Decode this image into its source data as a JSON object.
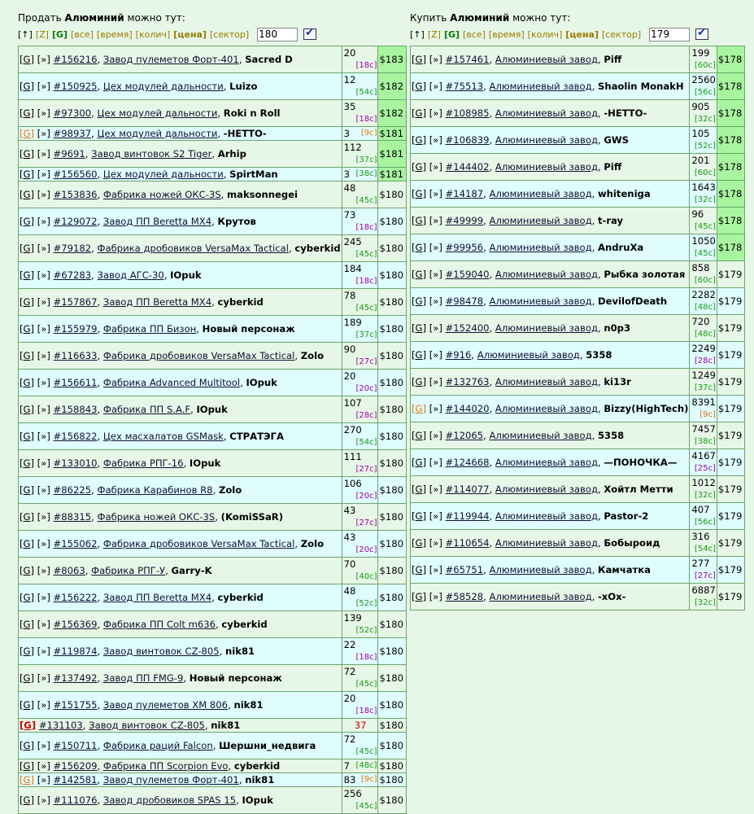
{
  "sell": {
    "title_prefix": "Продать",
    "title_item": "Алюминий",
    "title_suffix": "можно тут:",
    "sort": {
      "up": "[↑]",
      "z": "[Z]",
      "g": "[G]",
      "all": "[все]",
      "time": "[время]",
      "qty": "[колич]",
      "price": "[цена]",
      "sector": "[сектор]"
    },
    "input_value": "180",
    "rows": [
      {
        "g": "[G]",
        "r": "[»]",
        "id": "#156216",
        "factory": "Завод пулеметов Форт-401",
        "owner": "Sacred D",
        "qty": "20",
        "age": "[18c]",
        "age_color": "purple",
        "price": "$183",
        "hl": true
      },
      {
        "g": "[G]",
        "r": "[»]",
        "id": "#150925",
        "factory": "Цех модулей дальности",
        "owner": "Luizo",
        "qty": "12",
        "age": "[54c]",
        "age_color": "green",
        "price": "$182",
        "hl": true
      },
      {
        "g": "[G]",
        "r": "[»]",
        "id": "#97300",
        "factory": "Цех модулей дальности",
        "owner": "Roki n Roll",
        "qty": "35",
        "age": "[18c]",
        "age_color": "purple",
        "price": "$182",
        "hl": true
      },
      {
        "g": "[G]",
        "g_color": "orange",
        "r": "[»]",
        "id": "#98937",
        "factory": "Цех модулей дальности",
        "owner": "-НЕТТО-",
        "qty": "3",
        "age": "[9c]",
        "age_color": "orange",
        "price": "$181",
        "hl": true
      },
      {
        "g": "[G]",
        "r": "[»]",
        "id": "#9691",
        "factory": "Завод винтовок S2 Tiger",
        "owner": "Arhip",
        "qty": "112",
        "age": "[37c]",
        "age_color": "green",
        "price": "$181",
        "hl": true
      },
      {
        "g": "[G]",
        "r": "[»]",
        "id": "#156560",
        "factory": "Цех модулей дальности",
        "owner": "SpirtMan",
        "qty": "3",
        "age": "[38c]",
        "age_color": "green",
        "price": "$181",
        "hl": true
      },
      {
        "g": "[G]",
        "r": "[»]",
        "id": "#153836",
        "factory": "Фабрика ножей ОКС-3S",
        "owner": "maksonnegei",
        "qty": "48",
        "age": "[45c]",
        "age_color": "green",
        "price": "$180"
      },
      {
        "g": "[G]",
        "r": "[»]",
        "id": "#129072",
        "factory": "Завод ПП Beretta MX4",
        "owner": "Крутов",
        "qty": "73",
        "age": "[18c]",
        "age_color": "purple",
        "price": "$180"
      },
      {
        "g": "[G]",
        "r": "[»]",
        "id": "#79182",
        "factory": "Фабрика дробовиков VersaMax Tactical",
        "owner": "cyberkid",
        "qty": "245",
        "age": "[45c]",
        "age_color": "green",
        "price": "$180"
      },
      {
        "g": "[G]",
        "r": "[»]",
        "id": "#67283",
        "factory": "Завод АГС-30",
        "owner": "IOpuk",
        "qty": "184",
        "age": "[18c]",
        "age_color": "purple",
        "price": "$180"
      },
      {
        "g": "[G]",
        "r": "[»]",
        "id": "#157867",
        "factory": "Завод ПП Beretta MX4",
        "owner": "cyberkid",
        "qty": "78",
        "age": "[45c]",
        "age_color": "green",
        "price": "$180"
      },
      {
        "g": "[G]",
        "r": "[»]",
        "id": "#155979",
        "factory": "Фабрика ПП Бизон",
        "owner": "Новый персонаж",
        "qty": "189",
        "age": "[37c]",
        "age_color": "green",
        "price": "$180"
      },
      {
        "g": "[G]",
        "r": "[»]",
        "id": "#116633",
        "factory": "Фабрика дробовиков VersaMax Tactical",
        "owner": "Zolo",
        "qty": "90",
        "age": "[27c]",
        "age_color": "purple",
        "price": "$180"
      },
      {
        "g": "[G]",
        "r": "[»]",
        "id": "#156611",
        "factory": "Фабрика Advanced Multitool",
        "owner": "IOpuk",
        "qty": "20",
        "age": "[20c]",
        "age_color": "purple",
        "price": "$180"
      },
      {
        "g": "[G]",
        "r": "[»]",
        "id": "#158843",
        "factory": "Фабрика ПП S.A.F",
        "owner": "IOpuk",
        "qty": "107",
        "age": "[28c]",
        "age_color": "purple",
        "price": "$180"
      },
      {
        "g": "[G]",
        "r": "[»]",
        "id": "#156822",
        "factory": "Цех масхалатов GSMask",
        "owner": "СТРАТЭГА",
        "qty": "270",
        "age": "[54c]",
        "age_color": "green",
        "price": "$180"
      },
      {
        "g": "[G]",
        "r": "[»]",
        "id": "#133010",
        "factory": "Фабрика РПГ-16",
        "owner": "IOpuk",
        "qty": "111",
        "age": "[27c]",
        "age_color": "purple",
        "price": "$180"
      },
      {
        "g": "[G]",
        "r": "[»]",
        "id": "#86225",
        "factory": "Фабрика Карабинов R8",
        "owner": "Zolo",
        "qty": "106",
        "age": "[20c]",
        "age_color": "purple",
        "price": "$180"
      },
      {
        "g": "[G]",
        "r": "[»]",
        "id": "#88315",
        "factory": "Фабрика ножей ОКС-3S",
        "owner": "(KomiSSaR)",
        "qty": "43",
        "age": "[27c]",
        "age_color": "purple",
        "price": "$180"
      },
      {
        "g": "[G]",
        "r": "[»]",
        "id": "#155062",
        "factory": "Фабрика дробовиков VersaMax Tactical",
        "owner": "Zolo",
        "qty": "43",
        "age": "[20c]",
        "age_color": "purple",
        "price": "$180"
      },
      {
        "g": "[G]",
        "r": "[»]",
        "id": "#8063",
        "factory": "Фабрика РПГ-У",
        "owner": "Garry-K",
        "qty": "70",
        "age": "[40c]",
        "age_color": "green",
        "price": "$180"
      },
      {
        "g": "[G]",
        "r": "[»]",
        "id": "#156222",
        "factory": "Завод ПП Beretta MX4",
        "owner": "cyberkid",
        "qty": "48",
        "age": "[52c]",
        "age_color": "green",
        "price": "$180"
      },
      {
        "g": "[G]",
        "r": "[»]",
        "id": "#156369",
        "factory": "Фабрика ПП Colt m636",
        "owner": "cyberkid",
        "qty": "139",
        "age": "[52c]",
        "age_color": "green",
        "price": "$180"
      },
      {
        "g": "[G]",
        "r": "[»]",
        "id": "#119874",
        "factory": "Завод винтовок CZ-805",
        "owner": "nik81",
        "qty": "22",
        "age": "[18c]",
        "age_color": "purple",
        "price": "$180"
      },
      {
        "g": "[G]",
        "r": "[»]",
        "id": "#137492",
        "factory": "Завод ПП FMG-9",
        "owner": "Новый персонаж",
        "qty": "72",
        "age": "[45c]",
        "age_color": "green",
        "price": "$180"
      },
      {
        "g": "[G]",
        "r": "[»]",
        "id": "#151755",
        "factory": "Завод пулеметов ХМ 806",
        "owner": "nik81",
        "qty": "20",
        "age": "[18c]",
        "age_color": "purple",
        "price": "$180"
      },
      {
        "g": "[G]",
        "g_color": "red",
        "r": "",
        "id": "#131103",
        "factory": "Завод винтовок CZ-805",
        "owner": "nik81",
        "qty": "37",
        "age": "",
        "age_color": "red",
        "qty_red": true,
        "price": "$180"
      },
      {
        "g": "[G]",
        "r": "[»]",
        "id": "#150711",
        "factory": "Фабрика раций Falcon",
        "owner": "Шершни_недвига",
        "qty": "72",
        "age": "[45c]",
        "age_color": "green",
        "price": "$180"
      },
      {
        "g": "[G]",
        "r": "[»]",
        "id": "#156209",
        "factory": "Фабрика ПП Scorpion Evo",
        "owner": "cyberkid",
        "qty": "7",
        "age": "[48c]",
        "age_color": "green",
        "price": "$180"
      },
      {
        "g": "[G]",
        "g_color": "orange",
        "r": "[»]",
        "id": "#142581",
        "factory": "Завод пулеметов Форт-401",
        "owner": "nik81",
        "qty": "83",
        "age": "[9c]",
        "age_color": "orange",
        "price": "$180"
      },
      {
        "g": "[G]",
        "r": "[»]",
        "id": "#111076",
        "factory": "Завод дробовиков SPAS 15",
        "owner": "IOpuk",
        "qty": "256",
        "age": "[45c]",
        "age_color": "green",
        "price": "$180"
      }
    ]
  },
  "buy": {
    "title_prefix": "Купить",
    "title_item": "Алюминий",
    "title_suffix": "можно тут:",
    "sort": {
      "up": "[↑]",
      "z": "[Z]",
      "g": "[G]",
      "all": "[все]",
      "time": "[время]",
      "qty": "[колич]",
      "price": "[цена]",
      "sector": "[сектор]"
    },
    "input_value": "179",
    "rows": [
      {
        "g": "[G]",
        "r": "[»]",
        "id": "#157461",
        "factory": "Алюминиевый завод",
        "owner": "Piff",
        "qty": "199",
        "age": "[60c]",
        "age_color": "green",
        "price": "$178",
        "hl": true
      },
      {
        "g": "[G]",
        "r": "[»]",
        "id": "#75513",
        "factory": "Алюминиевый завод",
        "owner": "Shaolin MonakH",
        "qty": "2560",
        "age": "[56c]",
        "age_color": "green",
        "price": "$178",
        "hl": true
      },
      {
        "g": "[G]",
        "r": "[»]",
        "id": "#108985",
        "factory": "Алюминиевый завод",
        "owner": "-НЕТТО-",
        "qty": "905",
        "age": "[32c]",
        "age_color": "green",
        "price": "$178",
        "hl": true
      },
      {
        "g": "[G]",
        "r": "[»]",
        "id": "#106839",
        "factory": "Алюминиевый завод",
        "owner": "GWS",
        "qty": "105",
        "age": "[52c]",
        "age_color": "green",
        "price": "$178",
        "hl": true
      },
      {
        "g": "[G]",
        "r": "[»]",
        "id": "#144402",
        "factory": "Алюминиевый завод",
        "owner": "Piff",
        "qty": "201",
        "age": "[60c]",
        "age_color": "green",
        "price": "$178",
        "hl": true
      },
      {
        "g": "[G]",
        "r": "[»]",
        "id": "#14187",
        "factory": "Алюминиевый завод",
        "owner": "whiteniga",
        "qty": "1643",
        "age": "[32c]",
        "age_color": "green",
        "price": "$178",
        "hl": true
      },
      {
        "g": "[G]",
        "r": "[»]",
        "id": "#49999",
        "factory": "Алюминиевый завод",
        "owner": "t-ray",
        "qty": "96",
        "age": "[45c]",
        "age_color": "green",
        "price": "$178",
        "hl": true
      },
      {
        "g": "[G]",
        "r": "[»]",
        "id": "#99956",
        "factory": "Алюминиевый завод",
        "owner": "AndruXa",
        "qty": "1050",
        "age": "[45c]",
        "age_color": "green",
        "price": "$178",
        "hl": true
      },
      {
        "g": "[G]",
        "r": "[»]",
        "id": "#159040",
        "factory": "Алюминиевый завод",
        "owner": "Рыбка золотая",
        "qty": "858",
        "age": "[60c]",
        "age_color": "green",
        "price": "$179"
      },
      {
        "g": "[G]",
        "r": "[»]",
        "id": "#98478",
        "factory": "Алюминиевый завод",
        "owner": "DevilofDeath",
        "qty": "2282",
        "age": "[48c]",
        "age_color": "green",
        "price": "$179"
      },
      {
        "g": "[G]",
        "r": "[»]",
        "id": "#152400",
        "factory": "Алюминиевый завод",
        "owner": "n0p3",
        "qty": "720",
        "age": "[48c]",
        "age_color": "green",
        "price": "$179"
      },
      {
        "g": "[G]",
        "r": "[»]",
        "id": "#916",
        "factory": "Алюминиевый завод",
        "owner": "5358",
        "qty": "2249",
        "age": "[28c]",
        "age_color": "purple",
        "price": "$179"
      },
      {
        "g": "[G]",
        "r": "[»]",
        "id": "#132763",
        "factory": "Алюминиевый завод",
        "owner": "ki13r",
        "qty": "1249",
        "age": "[37c]",
        "age_color": "green",
        "price": "$179"
      },
      {
        "g": "[G]",
        "g_color": "orange",
        "r": "[»]",
        "id": "#144020",
        "factory": "Алюминиевый завод",
        "owner": "Bizzy(HighTech)",
        "qty": "8391",
        "age": "[9c]",
        "age_color": "orange",
        "price": "$179"
      },
      {
        "g": "[G]",
        "r": "[»]",
        "id": "#12065",
        "factory": "Алюминиевый завод",
        "owner": "5358",
        "qty": "7457",
        "age": "[38c]",
        "age_color": "green",
        "price": "$179"
      },
      {
        "g": "[G]",
        "r": "[»]",
        "id": "#124668",
        "factory": "Алюминиевый завод",
        "owner": "—ПОНОЧКА—",
        "qty": "4167",
        "age": "[25c]",
        "age_color": "purple",
        "price": "$179"
      },
      {
        "g": "[G]",
        "r": "[»]",
        "id": "#114077",
        "factory": "Алюминиевый завод",
        "owner": "Хойтл Метти",
        "qty": "1012",
        "age": "[32c]",
        "age_color": "green",
        "price": "$179"
      },
      {
        "g": "[G]",
        "r": "[»]",
        "id": "#119944",
        "factory": "Алюминиевый завод",
        "owner": "Pastor-2",
        "qty": "407",
        "age": "[56c]",
        "age_color": "green",
        "price": "$179"
      },
      {
        "g": "[G]",
        "r": "[»]",
        "id": "#110654",
        "factory": "Алюминиевый завод",
        "owner": "Бобыроид",
        "qty": "316",
        "age": "[54c]",
        "age_color": "green",
        "price": "$179"
      },
      {
        "g": "[G]",
        "r": "[»]",
        "id": "#65751",
        "factory": "Алюминиевый завод",
        "owner": "Камчатка",
        "qty": "277",
        "age": "[27c]",
        "age_color": "purple",
        "price": "$179"
      },
      {
        "g": "[G]",
        "r": "[»]",
        "id": "#58528",
        "factory": "Алюминиевый завод",
        "owner": "-xOx-",
        "qty": "6887",
        "age": "[32c]",
        "age_color": "green",
        "price": "$179"
      }
    ]
  }
}
